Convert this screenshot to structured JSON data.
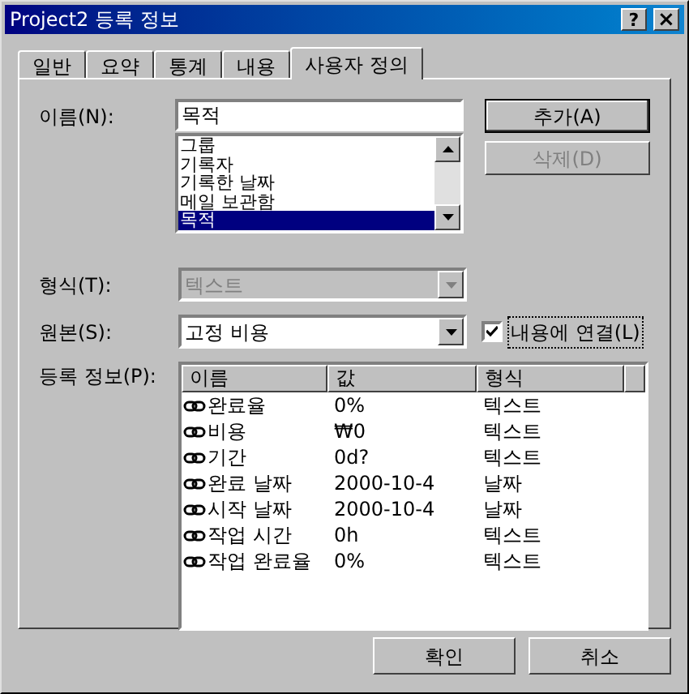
{
  "window": {
    "title": "Project2 등록 정보",
    "help_button": "?",
    "close_button": "×"
  },
  "tabs": [
    {
      "label": "일반",
      "selected": false
    },
    {
      "label": "요약",
      "selected": false
    },
    {
      "label": "통계",
      "selected": false
    },
    {
      "label": "내용",
      "selected": false
    },
    {
      "label": "사용자 정의",
      "selected": true
    }
  ],
  "name_field": {
    "label": "이름(N):",
    "value": "목적"
  },
  "name_list": [
    {
      "label": "그룹",
      "selected": false
    },
    {
      "label": "기록자",
      "selected": false
    },
    {
      "label": "기록한 날짜",
      "selected": false
    },
    {
      "label": "메일 보관함",
      "selected": false
    },
    {
      "label": "목적",
      "selected": true
    }
  ],
  "side_buttons": [
    {
      "label": "추가(A)",
      "disabled": false
    },
    {
      "label": "삭제(D)",
      "disabled": true
    }
  ],
  "type_field": {
    "label": "형식(T):",
    "value": "텍스트",
    "disabled": true
  },
  "source_field": {
    "label": "원본(S):",
    "value": "고정 비용",
    "disabled": false
  },
  "link_checkbox": {
    "label": "내용에 연결(L)",
    "checked": true
  },
  "properties": {
    "label": "등록 정보(P):",
    "columns": [
      "이름",
      "값",
      "형식"
    ],
    "rows": [
      {
        "name": "완료율",
        "value": "0%",
        "type": "텍스트"
      },
      {
        "name": "비용",
        "value": "₩0",
        "type": "텍스트"
      },
      {
        "name": "기간",
        "value": "0d?",
        "type": "텍스트"
      },
      {
        "name": "완료 날짜",
        "value": "2000-10-4",
        "type": "날짜"
      },
      {
        "name": "시작 날짜",
        "value": "2000-10-4",
        "type": "날짜"
      },
      {
        "name": "작업 시간",
        "value": "0h",
        "type": "텍스트"
      },
      {
        "name": "작업 완료율",
        "value": "0%",
        "type": "텍스트"
      }
    ]
  },
  "buttons": [
    "확인",
    "취소"
  ]
}
